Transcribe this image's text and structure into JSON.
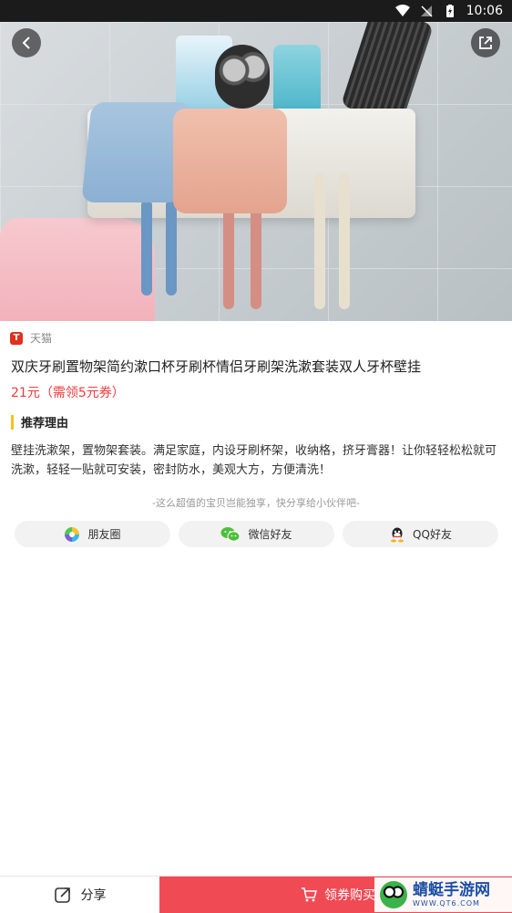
{
  "status_bar": {
    "time": "10:06"
  },
  "source": {
    "name": "天猫",
    "logo_letter": "T"
  },
  "product": {
    "title": "双庆牙刷置物架简约漱口杯牙刷杯情侣牙刷架洗漱套装双人牙杯壁挂",
    "price": "21元",
    "coupon": "（需领5元券）"
  },
  "reason": {
    "title": "推荐理由",
    "text": "壁挂洗漱架，置物架套装。满足家庭，内设牙刷杯架，收纳格，挤牙膏器！让你轻轻松松就可洗漱，轻轻一贴就可安装，密封防水，美观大方，方便清洗！"
  },
  "share": {
    "hint": "-这么超值的宝贝岂能独享，快分享给小伙伴吧-",
    "moments": "朋友圈",
    "wechat": "微信好友",
    "qq": "QQ好友"
  },
  "bottom": {
    "share_label": "分享",
    "buy_label": "领券购买"
  },
  "watermark": {
    "title": "蜻蜓手游网",
    "url": "WWW.QT6.COM"
  },
  "colors": {
    "price": "#f23b3b",
    "buy_bg": "#f04a55",
    "accent_bar": "#f5c21b"
  }
}
